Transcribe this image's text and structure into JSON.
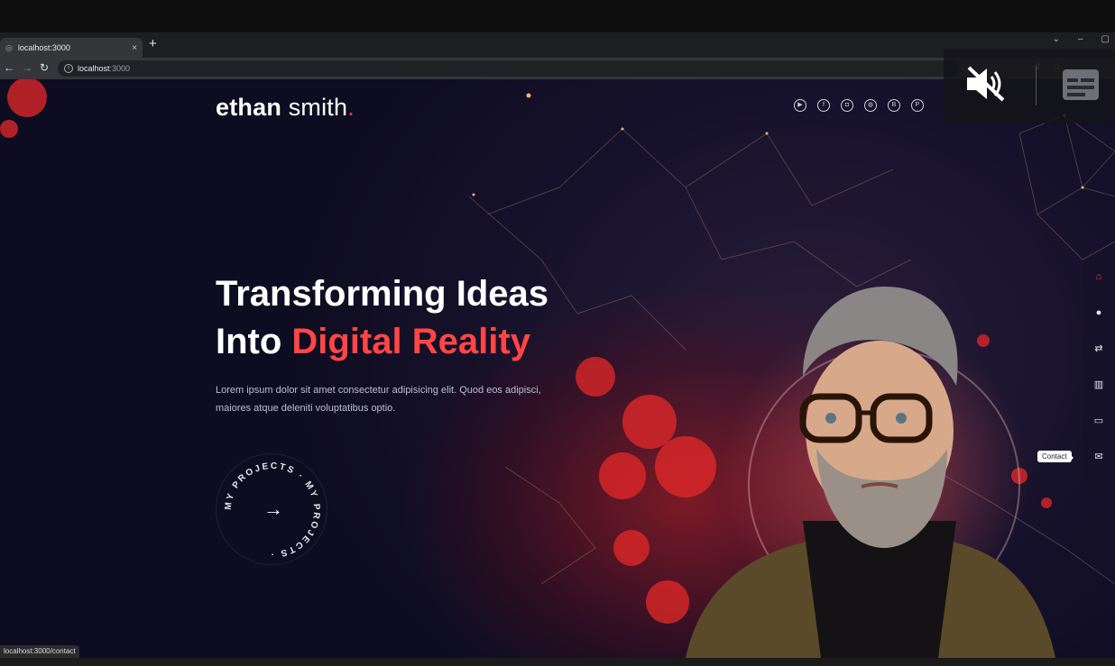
{
  "browser": {
    "tab_title": "localhost:3000",
    "tab_close": "×",
    "new_tab": "+",
    "url_host": "localhost",
    "url_port": ":3000",
    "status_url": "localhost:3000/contact"
  },
  "site": {
    "logo_bold": "ethan",
    "logo_light": " smith",
    "logo_dot": ".",
    "socials": [
      "youtube-icon",
      "facebook-icon",
      "instagram-icon",
      "dribbble-icon",
      "behance-icon",
      "pinterest-icon"
    ],
    "hero": {
      "line1": "Transforming Ideas",
      "line2_prefix": "Into ",
      "line2_accent": "Digital Reality",
      "text": "Lorem ipsum dolor sit amet consectetur adipisicing elit. Quod eos adipisci, maiores atque deleniti voluptatibus optio."
    },
    "projects_button": {
      "ring_text": "MY PROJECTS · MY PROJECTS ·",
      "arrow": "→"
    },
    "sidenav": {
      "items": [
        "home-icon",
        "user-icon",
        "services-icon",
        "portfolio-icon",
        "testimonials-icon",
        "contact-icon"
      ],
      "tooltip": "Contact"
    }
  },
  "colors": {
    "accent": "#ff4545",
    "bg": "#15112a",
    "chrome": "#35363a"
  }
}
